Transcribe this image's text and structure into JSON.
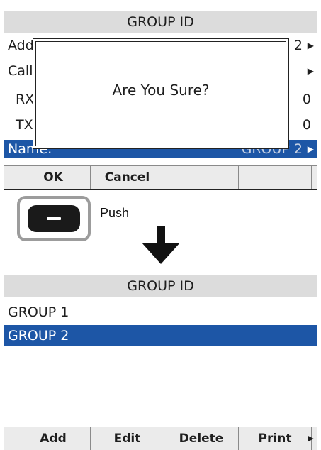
{
  "top_screen": {
    "title": "GROUP ID",
    "rows": [
      {
        "label": "Add",
        "value": "2",
        "arrow": "▶"
      },
      {
        "label": "Call",
        "value": "",
        "arrow": "▶"
      },
      {
        "label": "RX",
        "value": "0",
        "arrow": ""
      },
      {
        "label": "TX",
        "value": "0",
        "arrow": ""
      },
      {
        "label": "Name:",
        "value": "GROUP 2",
        "arrow": "▶"
      }
    ],
    "dialog": {
      "message": "Are You Sure?"
    },
    "softkeys": [
      "OK",
      "Cancel",
      "",
      ""
    ]
  },
  "instruction": {
    "push_label": "Push"
  },
  "bottom_screen": {
    "title": "GROUP ID",
    "list": [
      "GROUP 1",
      "GROUP 2"
    ],
    "selected_index": 1,
    "softkeys": [
      "Add",
      "Edit",
      "Delete",
      "Print"
    ],
    "more_arrow": "▶"
  },
  "colors": {
    "selection": "#1d56a6",
    "title_bg": "#dcdcdc",
    "softkey_bg": "#ebebeb"
  }
}
